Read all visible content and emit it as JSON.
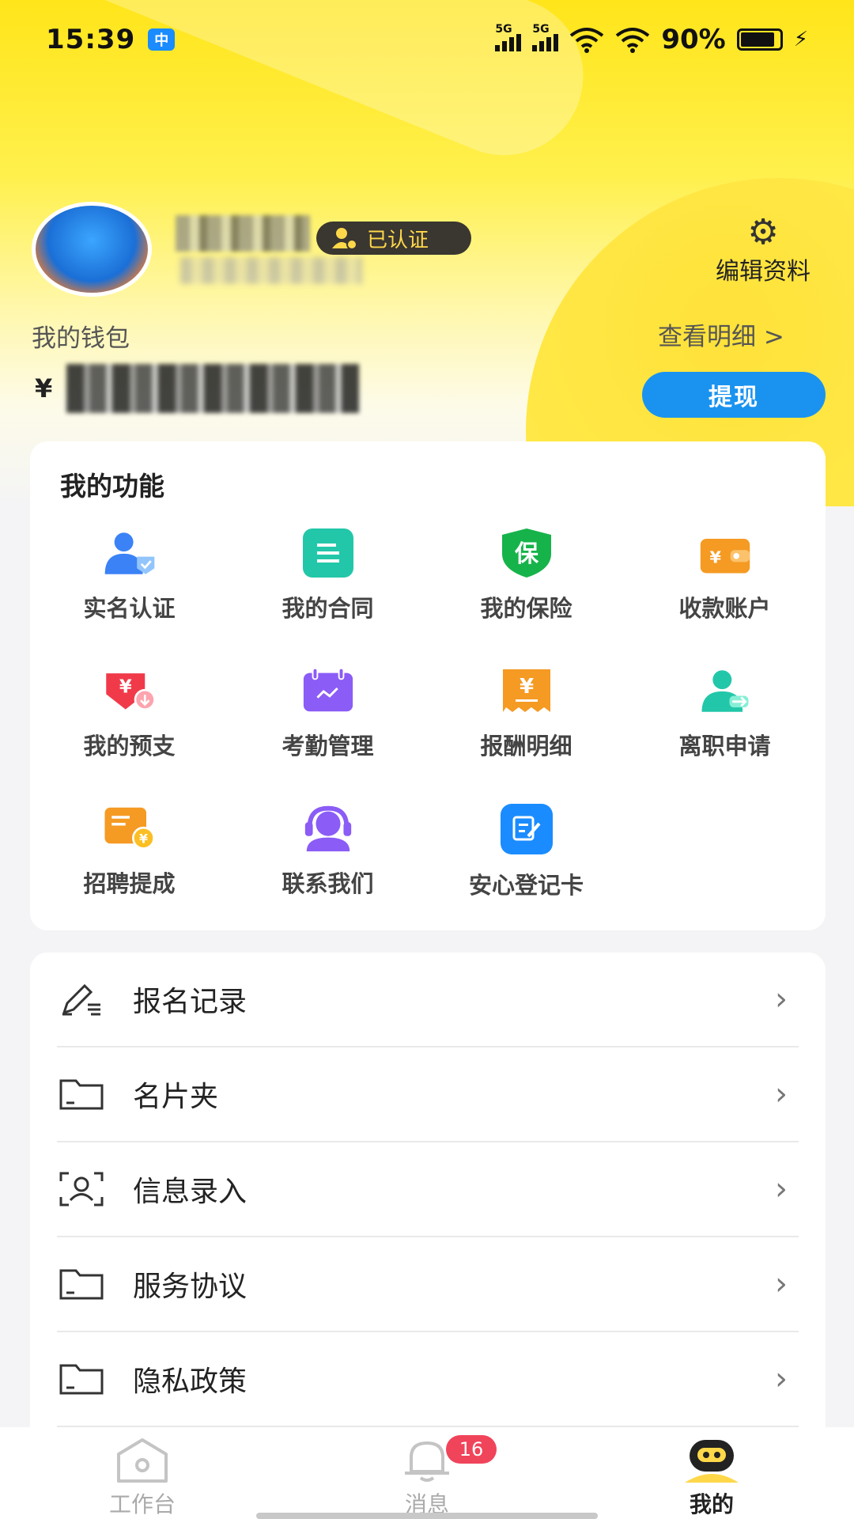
{
  "status_bar": {
    "time": "15:39",
    "app_icon": "中",
    "network1": "5G",
    "network2": "5G",
    "battery": "90%"
  },
  "profile": {
    "verified_label": "已认证",
    "edit_label": "编辑资料"
  },
  "wallet": {
    "label": "我的钱包",
    "detail_label": "查看明细 >",
    "currency": "¥",
    "withdraw_label": "提现"
  },
  "functions": {
    "title": "我的功能",
    "items": [
      {
        "label": "实名认证",
        "icon": "id-verify-icon",
        "color": "#3b82f6"
      },
      {
        "label": "我的合同",
        "icon": "contract-icon",
        "color": "#22c7a9"
      },
      {
        "label": "我的保险",
        "icon": "insurance-icon",
        "color": "#16b34a",
        "glyph": "保"
      },
      {
        "label": "收款账户",
        "icon": "wallet-icon",
        "color": "#f59a23",
        "glyph": "¥"
      },
      {
        "label": "我的预支",
        "icon": "advance-icon",
        "color": "#f03a4a",
        "glyph": "¥"
      },
      {
        "label": "考勤管理",
        "icon": "calendar-icon",
        "color": "#8b5cf6"
      },
      {
        "label": "报酬明细",
        "icon": "receipt-icon",
        "color": "#f59a23",
        "glyph": "¥"
      },
      {
        "label": "离职申请",
        "icon": "resign-icon",
        "color": "#22c7a9"
      },
      {
        "label": "招聘提成",
        "icon": "commission-icon",
        "color": "#f59a23",
        "glyph": "¥"
      },
      {
        "label": "联系我们",
        "icon": "headset-icon",
        "color": "#8b5cf6"
      },
      {
        "label": "安心登记卡",
        "icon": "register-card-icon",
        "color": "#1a8cff"
      }
    ]
  },
  "menu": [
    {
      "label": "报名记录",
      "icon": "edit-pen-icon"
    },
    {
      "label": "名片夹",
      "icon": "folder-icon"
    },
    {
      "label": "信息录入",
      "icon": "face-scan-icon"
    },
    {
      "label": "服务协议",
      "icon": "folder-icon"
    },
    {
      "label": "隐私政策",
      "icon": "folder-icon"
    }
  ],
  "tabs": {
    "workbench": "工作台",
    "messages": "消息",
    "messages_badge": "16",
    "mine": "我的"
  }
}
